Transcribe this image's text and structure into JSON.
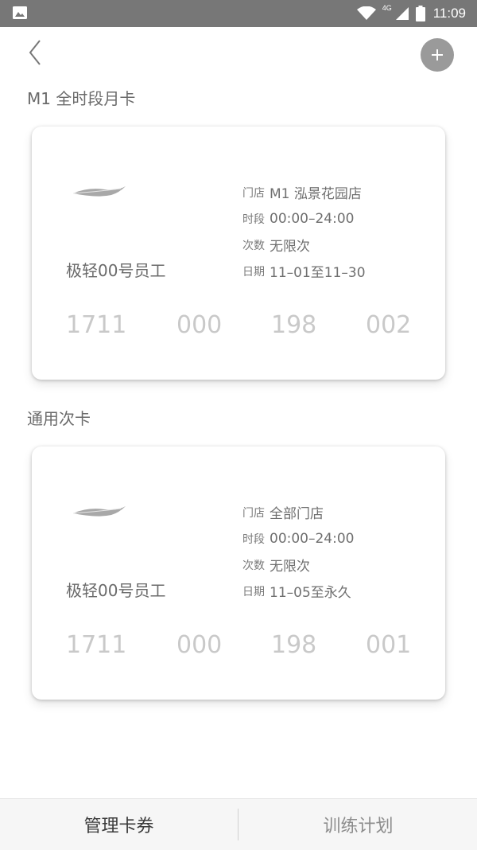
{
  "status_bar": {
    "network": "4G",
    "time": "11:09",
    "icons": [
      "image-icon",
      "wifi-icon",
      "signal-icon",
      "battery-icon"
    ]
  },
  "header": {
    "back_icon": "chevron-left-icon",
    "add_icon": "plus-icon"
  },
  "sections": [
    {
      "title": "M1 全时段月卡",
      "card": {
        "name": "极轻00号员工",
        "store_label": "门店",
        "store_value": "M1 泓景花园店",
        "time_label": "时段",
        "time_value": "00:00–24:00",
        "count_label": "次数",
        "count_value": "无限次",
        "date_label": "日期",
        "date_value": "11–01至11–30",
        "number_groups": [
          "1711",
          "000",
          "198",
          "002"
        ]
      }
    },
    {
      "title": "通用次卡",
      "card": {
        "name": "极轻00号员工",
        "store_label": "门店",
        "store_value": "全部门店",
        "time_label": "时段",
        "time_value": "00:00–24:00",
        "count_label": "次数",
        "count_value": "无限次",
        "date_label": "日期",
        "date_value": "11–05至永久",
        "number_groups": [
          "1711",
          "000",
          "198",
          "001"
        ]
      }
    }
  ],
  "tabs": [
    {
      "label": "管理卡券",
      "active": true
    },
    {
      "label": "训练计划",
      "active": false
    }
  ],
  "colors": {
    "status_bar": "#777777",
    "add_button": "#9a9a9a",
    "card_number": "#c9c9c9"
  }
}
